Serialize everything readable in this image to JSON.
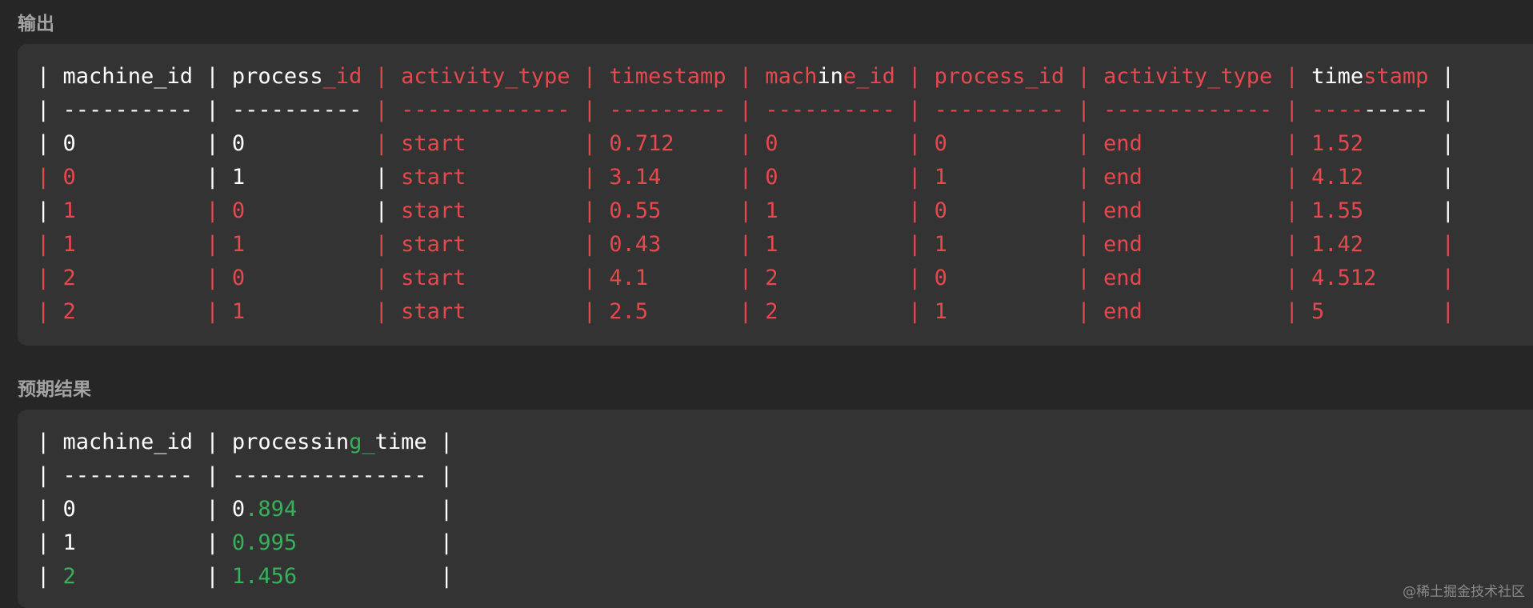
{
  "output_section": {
    "title": "输出",
    "lines": [
      [
        [
          "w",
          "| machine_id | process"
        ],
        [
          "r",
          "_id | activity_type | timestamp | mach"
        ],
        [
          "w",
          "in"
        ],
        [
          "r",
          "e_id | process_id | activity_type | "
        ],
        [
          "w",
          "time"
        ],
        [
          "r",
          "stamp "
        ],
        [
          "w",
          "|"
        ]
      ],
      [
        [
          "w",
          "| ---------- | ----------"
        ],
        [
          "r",
          " | ------------- | --------- | ---------- | ---------- | ------------- | ----"
        ],
        [
          "w",
          "----- |"
        ]
      ],
      [
        [
          "w",
          "| 0          | 0          "
        ],
        [
          "r",
          "| start         | 0.712     | 0          | 0          | end           | 1.52      "
        ],
        [
          "w",
          "|"
        ]
      ],
      [
        [
          "r",
          "| 0          "
        ],
        [
          "w",
          "| 1          |"
        ],
        [
          "r",
          " start         | 3.14      | 0          | 1          | end           | 4.12      "
        ],
        [
          "w",
          "|"
        ]
      ],
      [
        [
          "w",
          "| "
        ],
        [
          "r",
          "1          | 0          "
        ],
        [
          "w",
          "|"
        ],
        [
          "r",
          " start         | 0.55      | 1          | 0          | end           | 1.55      "
        ],
        [
          "w",
          "|"
        ]
      ],
      [
        [
          "r",
          "| 1          | 1          | start         | 0.43      | 1          | 1          | end           | 1.42      |"
        ]
      ],
      [
        [
          "r",
          "| 2          | 0          | start         | 4.1       | 2          | 0          | end           | 4.512     |"
        ]
      ],
      [
        [
          "r",
          "| 2          | 1          | start         | 2.5       | 2          | 1          | end           | 5         |"
        ]
      ]
    ]
  },
  "expected_section": {
    "title": "预期结果",
    "lines": [
      [
        [
          "w",
          "| machine_id | processin"
        ],
        [
          "g",
          "g_"
        ],
        [
          "w",
          "time |"
        ]
      ],
      [
        [
          "w",
          "| ---------- | --------------- |"
        ]
      ],
      [
        [
          "w",
          "| 0          | 0"
        ],
        [
          "g",
          ".894"
        ],
        [
          "w",
          "           |"
        ]
      ],
      [
        [
          "w",
          "| 1          | "
        ],
        [
          "g",
          "0.995"
        ],
        [
          "w",
          "           |"
        ]
      ],
      [
        [
          "w",
          "| "
        ],
        [
          "g",
          "2"
        ],
        [
          "w",
          "          | "
        ],
        [
          "g",
          "1.456"
        ],
        [
          "w",
          "           |"
        ]
      ]
    ]
  },
  "watermark": "@稀土掘金技术社区"
}
